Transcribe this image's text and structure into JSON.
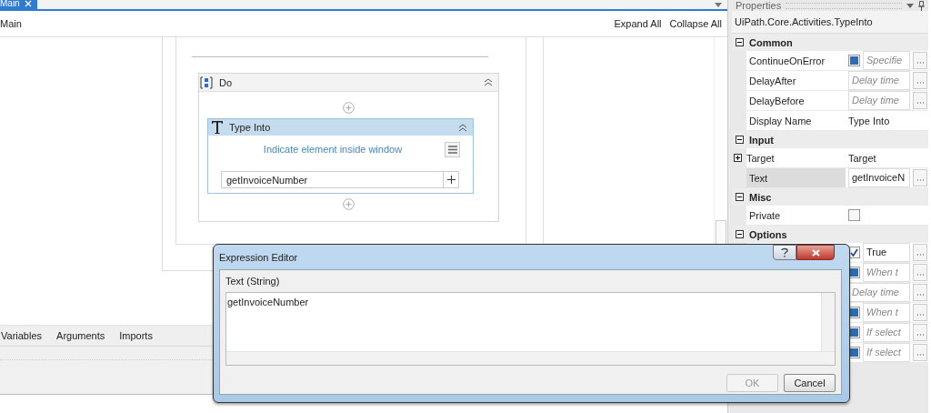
{
  "document_tab": {
    "label": "Main",
    "selected": true
  },
  "breadcrumb": "Main",
  "toolbar_links": [
    "Expand All",
    "Collapse All"
  ],
  "designer": {
    "sequence": {
      "title": "Do",
      "activity": {
        "title": "Type Into",
        "link": "Indicate element inside window",
        "text_value": "getInvoiceNumber"
      }
    }
  },
  "bottom_tabs": [
    "Variables",
    "Arguments",
    "Imports"
  ],
  "properties": {
    "title": "Properties",
    "type_name": "UiPath.Core.Activities.TypeInto",
    "categories": [
      {
        "name": "Common",
        "expanded": true,
        "rows": [
          {
            "label": "ContinueOnError",
            "kind": "field",
            "checked": false,
            "indeterminate": true,
            "placeholder": "Specifie",
            "selected": false
          },
          {
            "label": "DelayAfter",
            "kind": "field",
            "placeholder": "Delay time",
            "selected": false
          },
          {
            "label": "DelayBefore",
            "kind": "field",
            "placeholder": "Delay time",
            "selected": false
          },
          {
            "label": "Display Name",
            "kind": "text",
            "value": "Type Into",
            "selected": false
          }
        ]
      },
      {
        "name": "Input",
        "expanded": true,
        "rows": [
          {
            "label": "Target",
            "kind": "text",
            "value": "Target",
            "expanded": false,
            "selected": false
          },
          {
            "label": "Text",
            "kind": "field",
            "value": "getInvoiceN",
            "selected": true
          }
        ]
      },
      {
        "name": "Misc",
        "expanded": true,
        "rows": [
          {
            "label": "Private",
            "kind": "checkbox",
            "checked": false,
            "indeterminate": false,
            "selected": false
          }
        ]
      },
      {
        "name": "Options",
        "expanded": true,
        "rows": [
          {
            "kind": "field",
            "checked": true,
            "indeterminate": false,
            "value": "True"
          },
          {
            "kind": "field",
            "checked": false,
            "indeterminate": true,
            "placeholder": "When t"
          },
          {
            "kind": "field",
            "placeholder": "Delay time"
          },
          {
            "kind": "field",
            "checked": false,
            "indeterminate": true,
            "placeholder": "When t"
          },
          {
            "kind": "field",
            "checked": false,
            "indeterminate": true,
            "placeholder": "If select"
          },
          {
            "kind": "field",
            "checked": false,
            "indeterminate": true,
            "placeholder": "If select"
          }
        ]
      }
    ]
  },
  "dialog": {
    "title": "Expression Editor",
    "label": "Text (String)",
    "value": "getInvoiceNumber",
    "buttons": [
      {
        "label": "OK",
        "disabled": true
      },
      {
        "label": "Cancel",
        "disabled": false
      }
    ]
  }
}
